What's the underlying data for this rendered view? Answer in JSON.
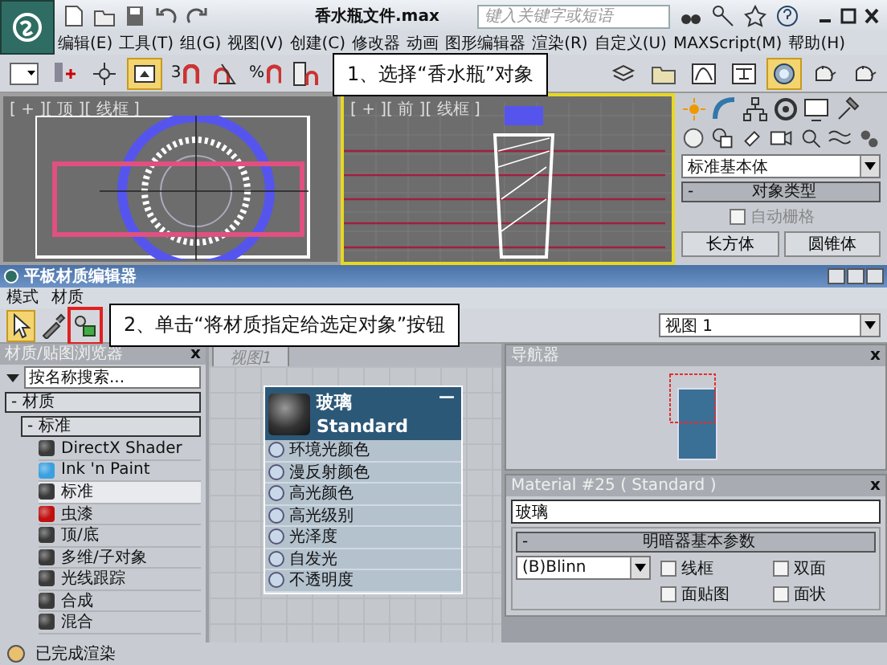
{
  "title_bar": {
    "title": "香水瓶文件.max",
    "search_placeholder": "键入关键字或短语"
  },
  "menu": [
    "编辑(E)",
    "工具(T)",
    "组(G)",
    "视图(V)",
    "创建(C)",
    "修改器",
    "动画",
    "图形编辑器",
    "渲染(R)",
    "自定义(U)",
    "MAXScript(M)",
    "帮助(H)"
  ],
  "main_toolbar": [
    {
      "kind": "dropdown",
      "selected": false
    },
    {
      "kind": "link",
      "selected": false
    },
    {
      "kind": "move",
      "selected": false
    },
    {
      "kind": "frame",
      "selected": true
    },
    {
      "kind": "snap",
      "glyph": "3",
      "selected": false
    },
    {
      "kind": "angle",
      "selected": false
    },
    {
      "kind": "snap",
      "glyph": "%",
      "selected": false
    },
    {
      "kind": "spinner",
      "selected": false
    }
  ],
  "right_toolbar": [
    {
      "kind": "layers",
      "selected": false
    },
    {
      "kind": "folder",
      "selected": false
    },
    {
      "kind": "curve",
      "selected": false
    },
    {
      "kind": "schematic",
      "selected": false
    },
    {
      "kind": "material",
      "selected": true
    },
    {
      "kind": "teapot",
      "selected": false
    },
    {
      "kind": "teapot",
      "selected": false
    }
  ],
  "callouts": [
    {
      "text": "1、选择“香水瓶”对象"
    },
    {
      "text": "2、单击“将材质指定给选定对象”按钮"
    }
  ],
  "viewports": [
    {
      "label": "[ + ][ 顶 ][ 线框 ]",
      "kind": "top",
      "selected": false
    },
    {
      "label": "[ + ][ 前 ][ 线框 ]",
      "kind": "front",
      "selected": true
    }
  ],
  "command_panel": {
    "dropdown": "标准基本体",
    "rollout_toggle": "-",
    "rollout": "对象类型",
    "auto_grid": {
      "label": "自动栅格",
      "checked": false,
      "disabled": true
    },
    "buttons": [
      "长方体",
      "圆锥体"
    ]
  },
  "material_editor": {
    "title": "平板材质编辑器",
    "menu": [
      "模式",
      "材质"
    ],
    "tools": [
      {
        "kind": "select",
        "selected": true,
        "highlighted": false
      },
      {
        "kind": "eyedropper",
        "selected": false,
        "highlighted": false
      },
      {
        "kind": "assign",
        "selected": false,
        "highlighted": true
      }
    ],
    "view_select": "视图 1",
    "browser": {
      "title": "材质/贴图浏览器",
      "close": "x",
      "search_placeholder": "按名称搜索...",
      "tree": [
        {
          "label": "- 材质",
          "children": [
            {
              "label": "- 标准",
              "children": [
                {
                  "label": "DirectX Shader",
                  "color": "#3a3a3a",
                  "selected": false
                },
                {
                  "label": "Ink 'n Paint",
                  "color": "#3aa0e0",
                  "selected": false
                },
                {
                  "label": "标准",
                  "color": "#3a3a3a",
                  "selected": true
                },
                {
                  "label": "虫漆",
                  "color": "#c01010",
                  "selected": false
                },
                {
                  "label": "顶/底",
                  "color": "#3a3a3a",
                  "selected": false
                },
                {
                  "label": "多维/子对象",
                  "color": "#3a3a3a",
                  "selected": false
                },
                {
                  "label": "光线跟踪",
                  "color": "#3a3a3a",
                  "selected": false
                },
                {
                  "label": "合成",
                  "color": "#3a3a3a",
                  "selected": false
                },
                {
                  "label": "混合",
                  "color": "#3a3a3a",
                  "selected": false
                }
              ]
            }
          ]
        }
      ]
    },
    "view_tab": "视图1",
    "node": {
      "title": "玻璃",
      "subtitle": "Standard",
      "collapse": "—",
      "slots": [
        "环境光颜色",
        "漫反射颜色",
        "高光颜色",
        "高光级别",
        "光泽度",
        "自发光",
        "不透明度"
      ]
    },
    "navigator": {
      "title": "导航器",
      "close": "x"
    },
    "material_panel": {
      "title": "Material #25 ( Standard )",
      "close": "x",
      "name": "玻璃",
      "rollout_toggle": "-",
      "rollout": "明暗器基本参数",
      "shader": "(B)Blinn",
      "options": [
        {
          "label": "线框",
          "checked": false
        },
        {
          "label": "双面",
          "checked": false
        },
        {
          "label": "面贴图",
          "checked": false
        },
        {
          "label": "面状",
          "checked": false
        }
      ]
    },
    "status": "已完成渲染"
  }
}
